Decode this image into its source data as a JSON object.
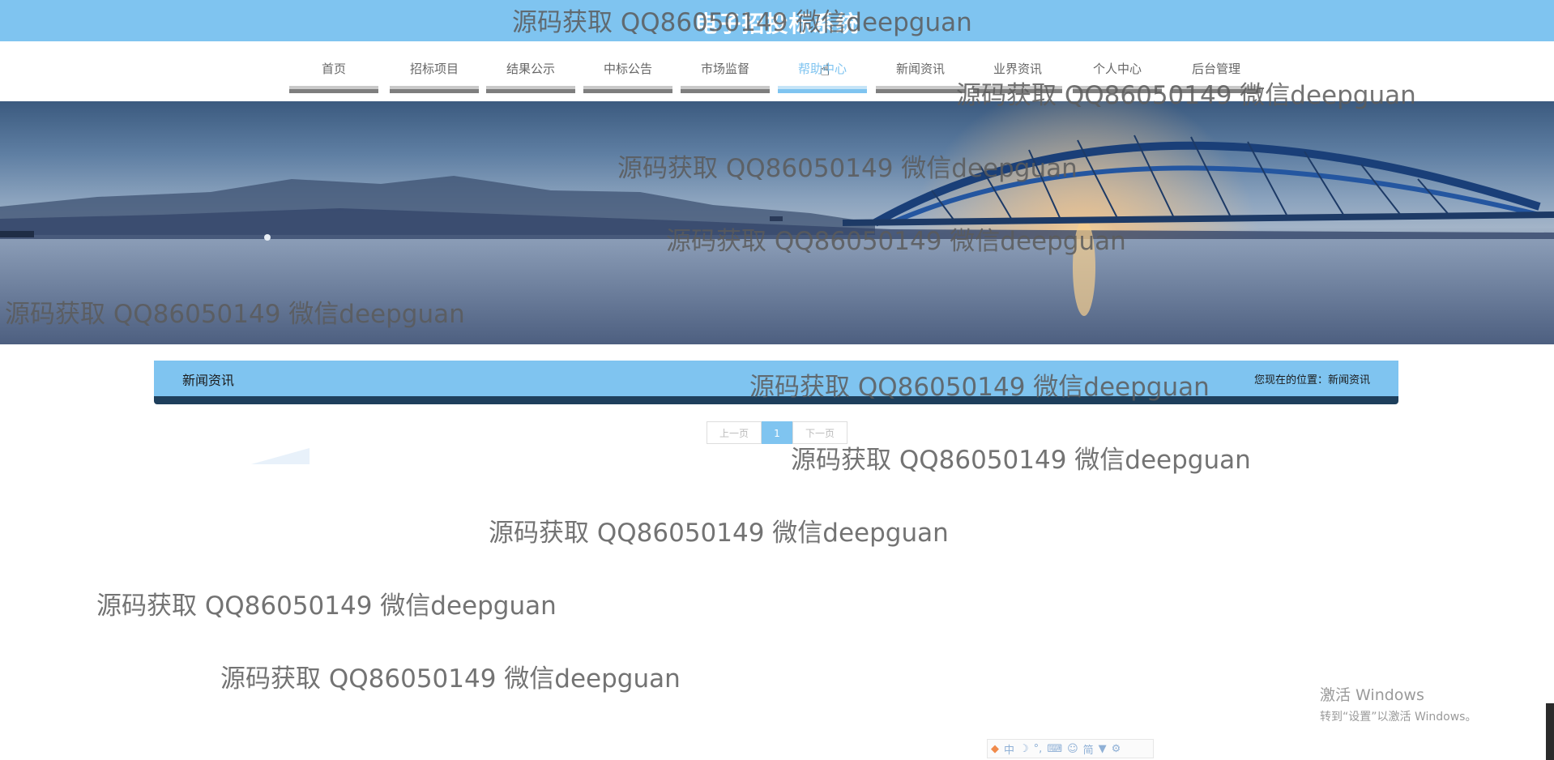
{
  "header": {
    "site_title": "电子招投标系统"
  },
  "nav": {
    "items": [
      {
        "label": "首页"
      },
      {
        "label": "招标项目"
      },
      {
        "label": "结果公示"
      },
      {
        "label": "中标公告"
      },
      {
        "label": "市场监督"
      },
      {
        "label": "帮助中心",
        "active": true
      },
      {
        "label": "新闻资讯"
      },
      {
        "label": "业界资讯"
      },
      {
        "label": "个人中心"
      },
      {
        "label": "后台管理"
      }
    ]
  },
  "section": {
    "title": "新闻资讯",
    "location_prefix": "您现在的位置：",
    "location_value": "新闻资讯"
  },
  "pager": {
    "prev_label": "上一页",
    "current_page": "1",
    "next_label": "下一页"
  },
  "watermark_text": "源码获取 QQ86050149 微信deepguan",
  "os_overlay": {
    "activate_title": "激活 Windows",
    "activate_hint": "转到“设置”以激活 Windows。",
    "ime_mode": "中",
    "ime_simplified": "简"
  },
  "colors": {
    "accent": "#7fc4f0",
    "section_bottom": "#1e3f5c",
    "nav_text": "#666666"
  }
}
